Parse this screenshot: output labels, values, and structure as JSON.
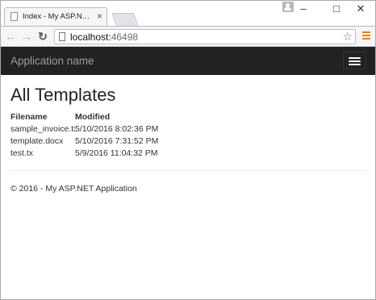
{
  "browser": {
    "tab_title": "Index - My ASP.NET Applica",
    "tab_close": "×",
    "window_buttons": {
      "minimize": "–",
      "maximize": "□",
      "close": "✕"
    },
    "nav": {
      "back": "←",
      "forward": "→",
      "reload": "↻"
    },
    "url_host": "localhost:",
    "url_port": "46498",
    "star": "☆"
  },
  "site": {
    "brand": "Application name",
    "page_title": "All Templates",
    "table": {
      "headers": [
        "Filename",
        "Modified"
      ],
      "rows": [
        [
          "sample_invoice.tx",
          "5/10/2016 8:02:36 PM"
        ],
        [
          "template.docx",
          "5/10/2016 7:31:52 PM"
        ],
        [
          "test.tx",
          "5/9/2016 11:04:32 PM"
        ]
      ]
    },
    "footer": "© 2016 - My ASP.NET Application"
  },
  "colors": {
    "navbar_bg": "#222222",
    "brand_text": "#9d9d9d",
    "menu_accent": "#e2811f"
  }
}
